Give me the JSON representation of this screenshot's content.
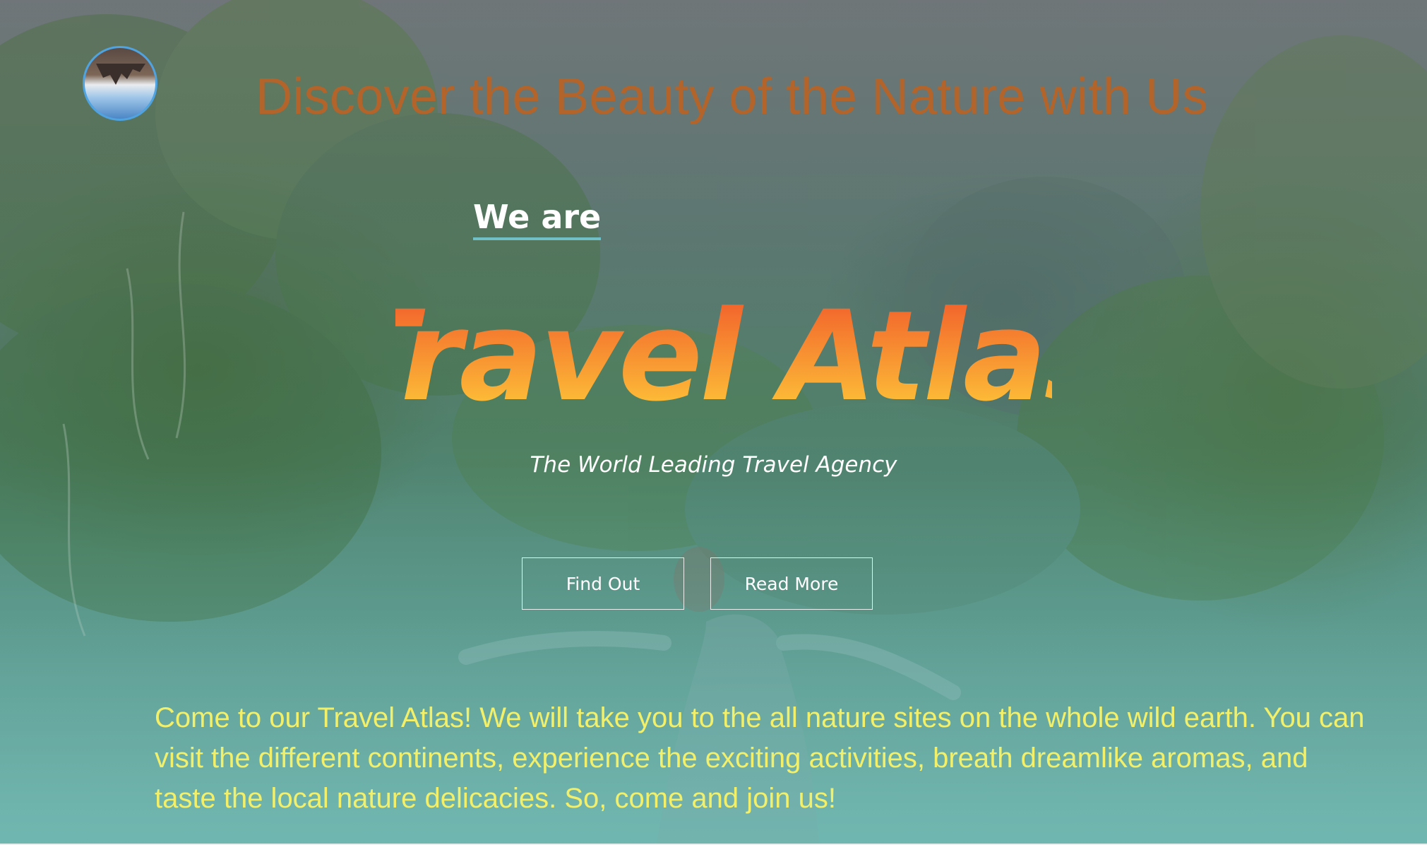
{
  "header": {
    "title": "Discover the Beauty of the Nature with Us",
    "logo_icon": "reflected-landscape-logo"
  },
  "hero": {
    "intro_label": "We are",
    "brand_name": "Travel Atlas",
    "tagline": "The World Leading Travel Agency",
    "buttons": {
      "find_out": "Find Out",
      "read_more": "Read More"
    },
    "description": "Come to our Travel Atlas! We will take you to the all nature sites on the whole wild earth. You can visit the different continents, experience the exciting activities, breath dreamlike aromas, and taste the local nature delicacies. So, come and join us!"
  },
  "colors": {
    "title": "#b3642a",
    "brand_gradient_top": "#f0542a",
    "brand_gradient_bottom": "#ffd23a",
    "description_text": "#f2f06a",
    "underline": "#6fc1c7"
  }
}
